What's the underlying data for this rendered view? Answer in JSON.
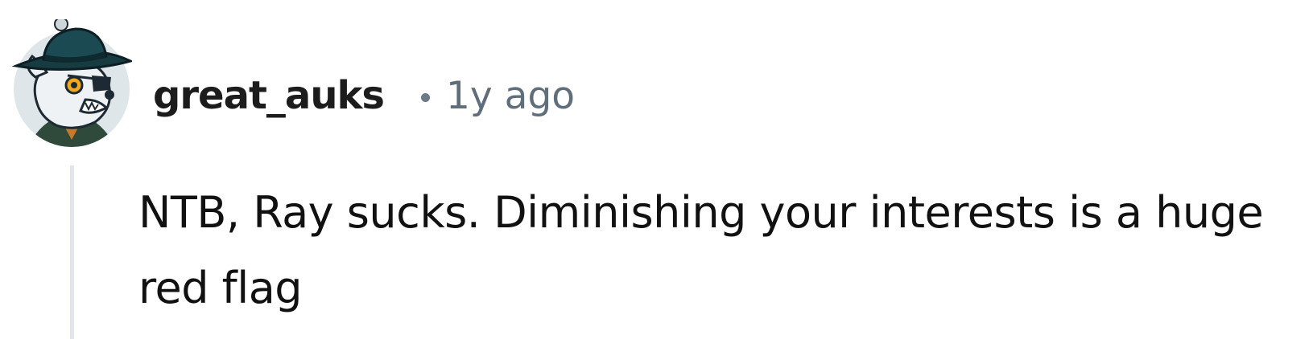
{
  "comment": {
    "author": "great_auks",
    "separator": "•",
    "timestamp": "1y ago",
    "body": "NTB, Ray sucks. Diminishing your interests is a huge red flag",
    "avatar_icon": "avatar-wolf-in-hat-icon"
  },
  "colors": {
    "username": "#1c1c1c",
    "timestamp": "#5f6e7a",
    "body_text": "#111111",
    "thread_line": "#e2e6e9",
    "avatar_bg": "#dfe6ea"
  }
}
